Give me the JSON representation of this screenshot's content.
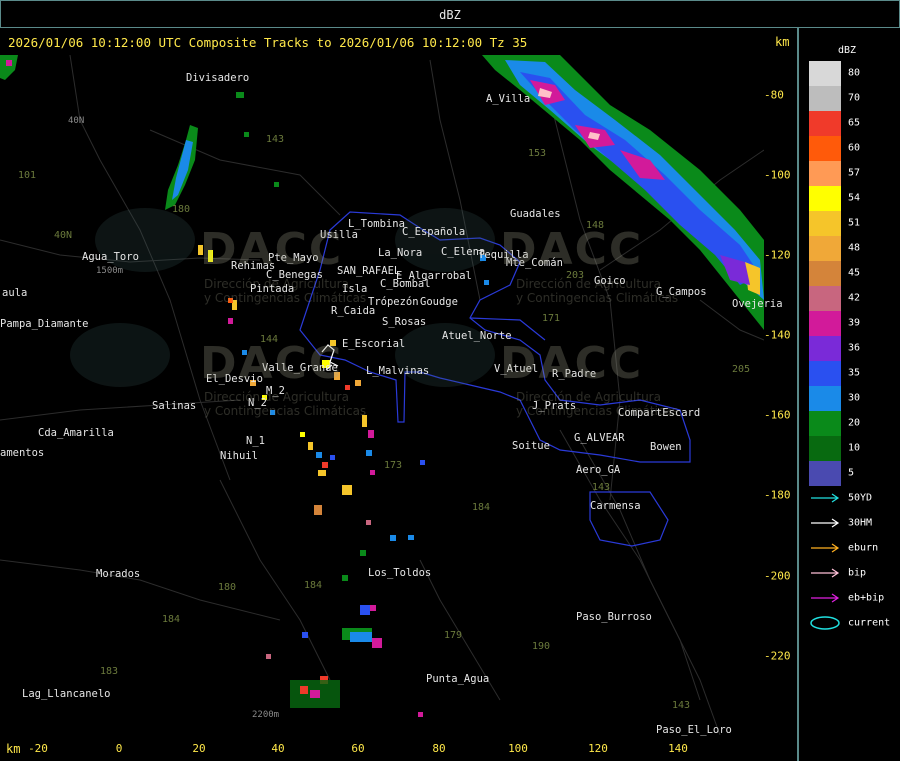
{
  "window": {
    "title": "dBZ"
  },
  "header": {
    "text": "2026/01/06 10:12:00 UTC Composite Tracks to 2026/01/06 10:12:00 Tz 35",
    "km_top": "km",
    "km_bottom": "km"
  },
  "x_axis": {
    "ticks": [
      "-20",
      "0",
      "20",
      "40",
      "60",
      "80",
      "100",
      "120",
      "140"
    ]
  },
  "y_axis": {
    "ticks": [
      "-80",
      "-100",
      "-120",
      "-140",
      "-160",
      "-180",
      "-200",
      "-220"
    ]
  },
  "places": [
    {
      "label": "Divisadero"
    },
    {
      "label": "A_Villa"
    },
    {
      "label": "Guadales"
    },
    {
      "label": "Usilla"
    },
    {
      "label": "L_Tombina"
    },
    {
      "label": "C_Española"
    },
    {
      "label": "La_Nora"
    },
    {
      "label": "C_Elena"
    },
    {
      "label": "Tequilla"
    },
    {
      "label": "Mte_Comán"
    },
    {
      "label": "Agua_Toro"
    },
    {
      "label": "Rehimas"
    },
    {
      "label": "Pte_Mayo"
    },
    {
      "label": "C_Benegas"
    },
    {
      "label": "SAN_RAFAEL"
    },
    {
      "label": "E_Algarrobal"
    },
    {
      "label": "C_Bombal"
    },
    {
      "label": "Goico"
    },
    {
      "label": "G_Campos"
    },
    {
      "label": "Ovejeria"
    },
    {
      "label": "aula"
    },
    {
      "label": "Pampa_Diamante"
    },
    {
      "label": "Pintada"
    },
    {
      "label": "Isla"
    },
    {
      "label": "Trópezón"
    },
    {
      "label": "Goudge"
    },
    {
      "label": "R_Caida"
    },
    {
      "label": "S_Rosas"
    },
    {
      "label": "Atuel_Norte"
    },
    {
      "label": "E_Escorial"
    },
    {
      "label": "El_Desvio"
    },
    {
      "label": "Valle_Grande"
    },
    {
      "label": "L_Malvinas"
    },
    {
      "label": "V_Atuel"
    },
    {
      "label": "R_Padre"
    },
    {
      "label": "Salinas"
    },
    {
      "label": "J_Prats"
    },
    {
      "label": "CompartEscard"
    },
    {
      "label": "Cda_Amarilla"
    },
    {
      "label": "amentos"
    },
    {
      "label": "N_1"
    },
    {
      "label": "Nihuil"
    },
    {
      "label": "Soitue"
    },
    {
      "label": "G_ALVEAR"
    },
    {
      "label": "Bowen"
    },
    {
      "label": "Aero_GA"
    },
    {
      "label": "Carmensa"
    },
    {
      "label": "Morados"
    },
    {
      "label": "Los_Toldos"
    },
    {
      "label": "Paso_Burroso"
    },
    {
      "label": "Lag_Llancanelo"
    },
    {
      "label": "Punta_Agua"
    },
    {
      "label": "Paso_El_Loro"
    },
    {
      "label": "N_2"
    },
    {
      "label": "M_2"
    },
    {
      "label": "1500m"
    },
    {
      "label": "2200m"
    },
    {
      "label": "40N"
    }
  ],
  "route_numbers": [
    "101",
    "143",
    "153",
    "148",
    "203",
    "171",
    "144",
    "173",
    "184",
    "180",
    "184",
    "183",
    "179",
    "190",
    "143",
    "205",
    "184",
    "40N",
    "143",
    "180"
  ],
  "watermark": {
    "logo_text": "DACC",
    "subtitle_1": "Dirección de Agricultura",
    "subtitle_2": "y Contingencias Climáticas"
  },
  "legend": {
    "title": "dBZ",
    "scale": [
      {
        "label": "80",
        "color": "#d8d8d8"
      },
      {
        "label": "70",
        "color": "#bdbdbd"
      },
      {
        "label": "65",
        "color": "#f03a2a"
      },
      {
        "label": "60",
        "color": "#ff5a0a"
      },
      {
        "label": "57",
        "color": "#ff9a55"
      },
      {
        "label": "54",
        "color": "#ffff00"
      },
      {
        "label": "51",
        "color": "#f5c52a"
      },
      {
        "label": "48",
        "color": "#f0a838"
      },
      {
        "label": "45",
        "color": "#d4843a"
      },
      {
        "label": "42",
        "color": "#c8667f"
      },
      {
        "label": "39",
        "color": "#d21a9a"
      },
      {
        "label": "36",
        "color": "#7a2ad8"
      },
      {
        "label": "35",
        "color": "#2a50f0"
      },
      {
        "label": "30",
        "color": "#1a8ae8"
      },
      {
        "label": "20",
        "color": "#0a8a1a"
      },
      {
        "label": "10",
        "color": "#086a10"
      },
      {
        "label": "5",
        "color": "#4a4ab0"
      }
    ],
    "tracks": [
      {
        "label": "50YD",
        "color": "#20e0e0"
      },
      {
        "label": "30HM",
        "color": "#ffffff"
      },
      {
        "label": "eburn",
        "color": "#ffb020"
      },
      {
        "label": "bip",
        "color": "#ffc0d8"
      },
      {
        "label": "eb+bip",
        "color": "#e020e0"
      },
      {
        "label": "current",
        "color": "#20e0e0"
      }
    ]
  }
}
